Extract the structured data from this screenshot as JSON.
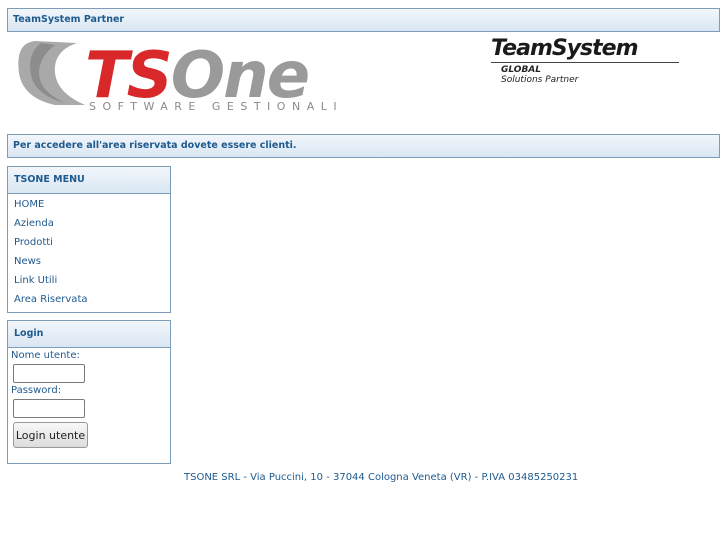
{
  "top_bar": {
    "title": "TeamSystem Partner"
  },
  "header": {
    "logo_main": "TSOne",
    "logo_sub": "SOFTWARE GESTIONALI",
    "partner_logo": "TeamSystem",
    "partner_sub1": "GLOBAL",
    "partner_sub2": "Solutions Partner"
  },
  "notice": {
    "text": "Per accedere all'area riservata dovete essere clienti."
  },
  "menu": {
    "title": "TSONE MENU",
    "items": [
      {
        "label": "HOME"
      },
      {
        "label": "Azienda"
      },
      {
        "label": "Prodotti"
      },
      {
        "label": "News"
      },
      {
        "label": "Link Utili"
      },
      {
        "label": "Area Riservata"
      }
    ]
  },
  "login": {
    "title": "Login",
    "username_label": "Nome utente:",
    "username_value": "",
    "password_label": "Password:",
    "password_value": "",
    "submit_label": "Login utente"
  },
  "footer": {
    "text": "TSONE SRL - Via Puccini, 10 - 37044 Cologna Veneta (VR) - P.IVA 03485250231"
  }
}
